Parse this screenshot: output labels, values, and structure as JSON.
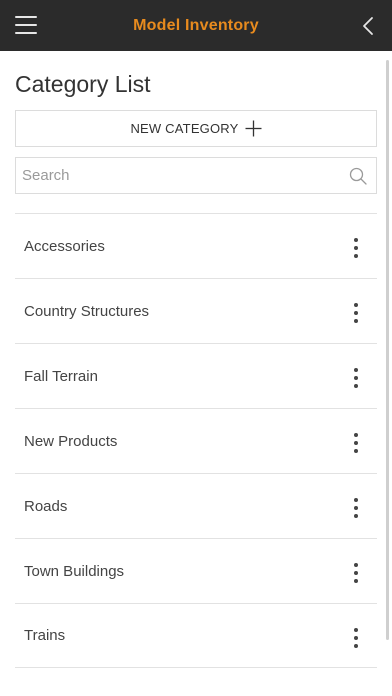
{
  "header": {
    "title": "Model Inventory",
    "menu_icon": "hamburger-menu-icon",
    "back_icon": "chevron-left-icon",
    "background": "#2b2b2b",
    "title_color": "#e88b1e"
  },
  "page": {
    "title": "Category List"
  },
  "new_category": {
    "label": "NEW CATEGORY",
    "icon": "plus-icon"
  },
  "search": {
    "placeholder": "Search",
    "value": "",
    "icon": "search-icon"
  },
  "categories": [
    {
      "label": "Accessories"
    },
    {
      "label": "Country Structures"
    },
    {
      "label": "Fall Terrain"
    },
    {
      "label": "New Products"
    },
    {
      "label": "Roads"
    },
    {
      "label": "Town Buildings"
    },
    {
      "label": "Trains"
    }
  ]
}
